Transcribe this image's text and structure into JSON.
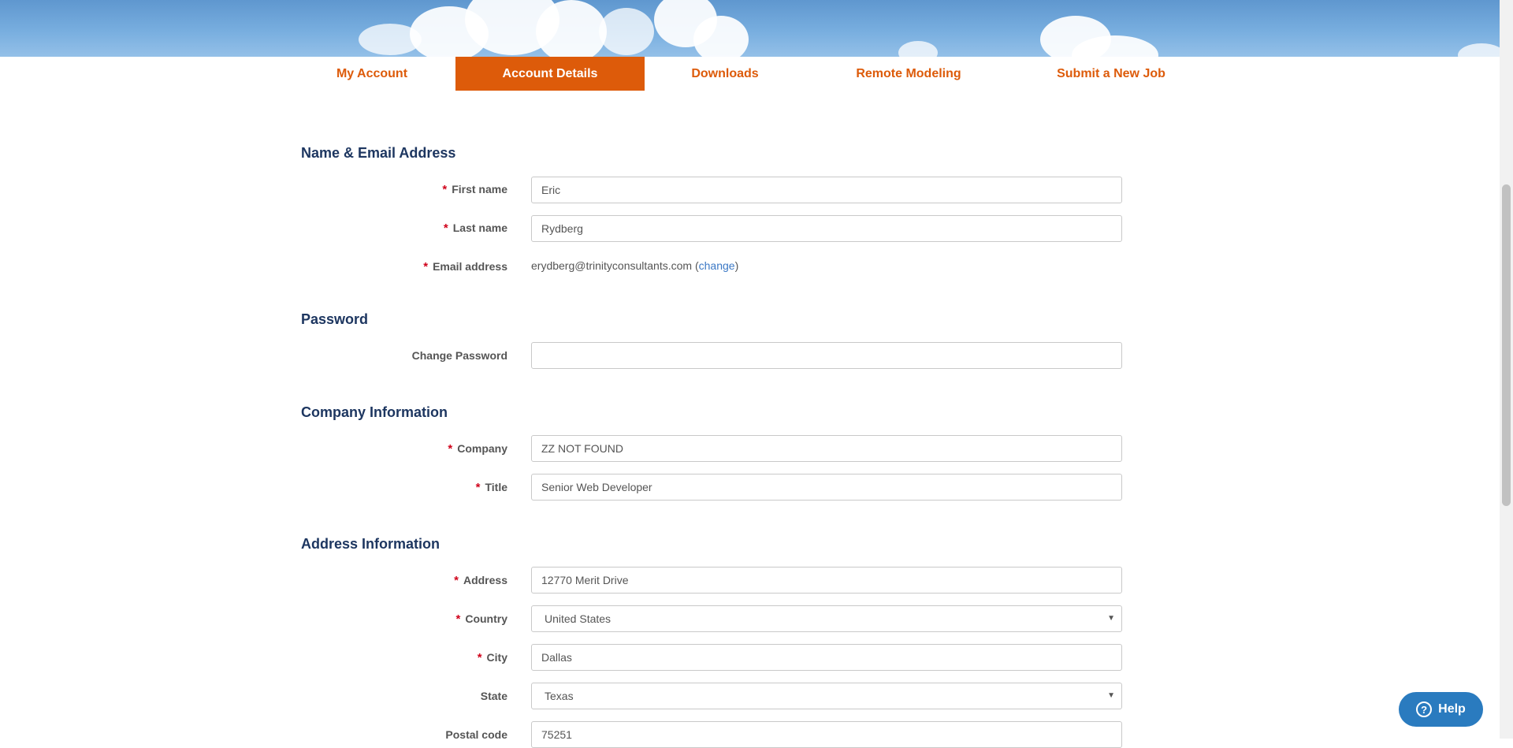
{
  "nav": {
    "tabs": [
      {
        "label": "My Account",
        "active": false
      },
      {
        "label": "Account Details",
        "active": true
      },
      {
        "label": "Downloads",
        "active": false
      },
      {
        "label": "Remote Modeling",
        "active": false
      },
      {
        "label": "Submit a New Job",
        "active": false
      }
    ]
  },
  "form": {
    "name_section": {
      "title": "Name & Email Address",
      "first_name": {
        "label": "First name",
        "value": "Eric",
        "required": true
      },
      "last_name": {
        "label": "Last name",
        "value": "Rydberg",
        "required": true
      },
      "email": {
        "label": "Email address",
        "value": "erydberg@trinityconsultants.com",
        "paren_open": " (",
        "change_link": "change",
        "paren_close": ")",
        "required": true
      }
    },
    "password_section": {
      "title": "Password",
      "change_password": {
        "label": "Change Password",
        "value": ""
      }
    },
    "company_section": {
      "title": "Company Information",
      "company": {
        "label": "Company",
        "value": "ZZ NOT FOUND",
        "required": true
      },
      "title_field": {
        "label": "Title",
        "value": "Senior Web Developer",
        "required": true
      }
    },
    "address_section": {
      "title": "Address Information",
      "address": {
        "label": "Address",
        "value": "12770 Merit Drive",
        "required": true
      },
      "country": {
        "label": "Country",
        "value": "United States",
        "required": true
      },
      "city": {
        "label": "City",
        "value": "Dallas",
        "required": true
      },
      "state": {
        "label": "State",
        "value": "Texas"
      },
      "postal_code": {
        "label": "Postal code",
        "value": "75251"
      }
    },
    "required_marker": "*"
  },
  "help": {
    "label": "Help",
    "icon": "question-circle-icon"
  },
  "colors": {
    "accent": "#dd5b0a",
    "heading": "#1d3660",
    "link": "#3b78c5",
    "required": "#d0021b",
    "help": "#2a7bbf"
  }
}
